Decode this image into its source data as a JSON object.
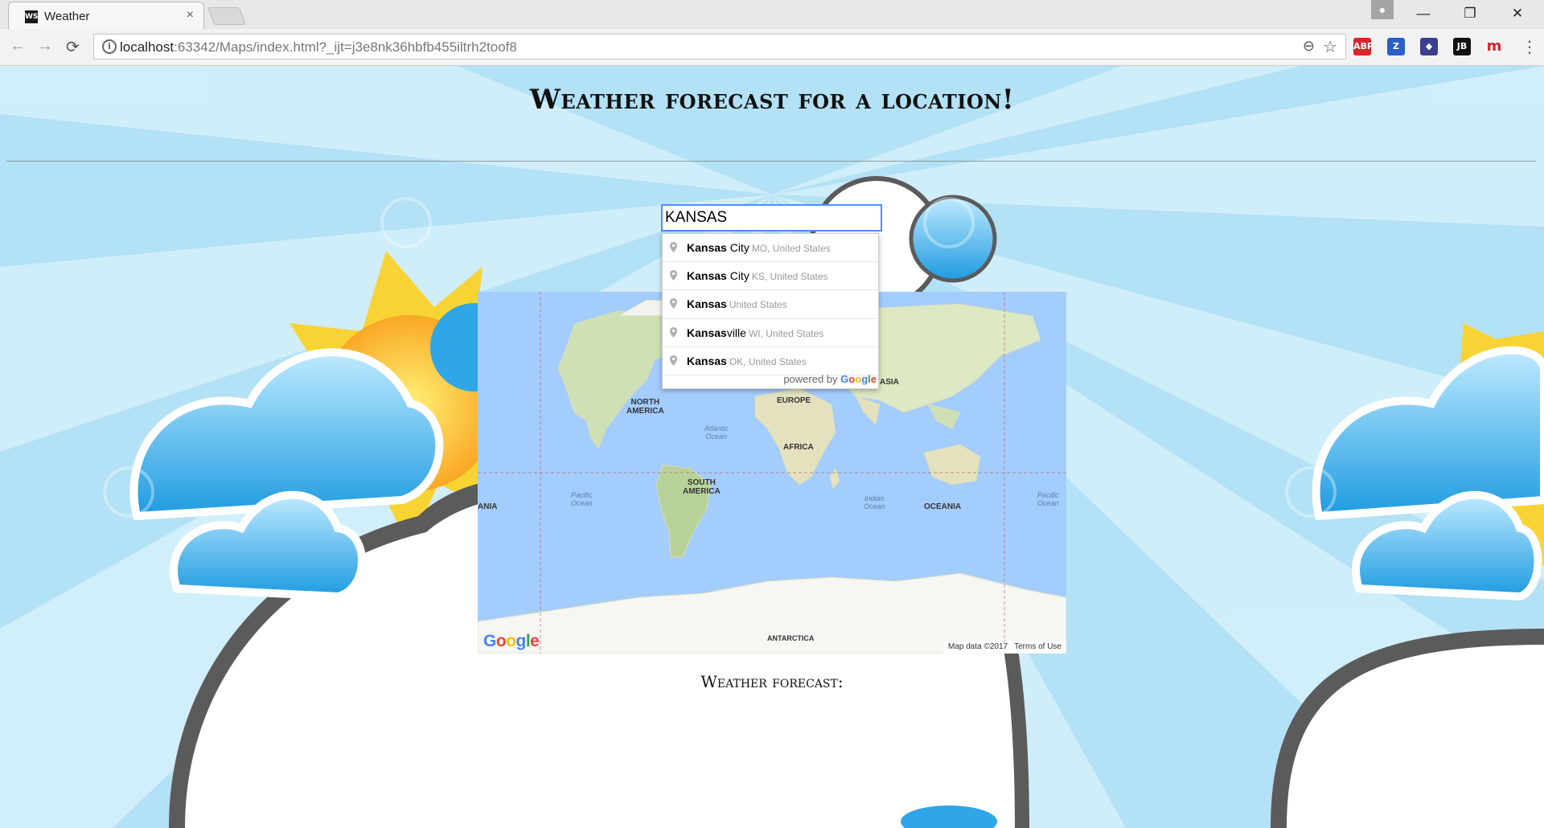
{
  "browser": {
    "tab_title": "Weather",
    "tab_favicon": "WS",
    "tab_close": "×",
    "url_host": "localhost",
    "url_rest": ":63342/Maps/index.html?_ijt=j3e8nk36hbfb455iltrh2toof8",
    "back_icon": "←",
    "forward_icon": "→",
    "reload_icon": "⟳",
    "minimize_icon": "—",
    "restore_icon": "❐",
    "close_icon": "✕",
    "extensions": [
      {
        "name": "adblock-plus-icon",
        "label": "ABP",
        "color": "#d8232a"
      },
      {
        "name": "zotero-icon",
        "label": "Z",
        "color": "#2b5fc7"
      },
      {
        "name": "extension-icon",
        "label": "◆",
        "color": "#3a3f8f"
      },
      {
        "name": "jetbrains-icon",
        "label": "JB",
        "color": "#111111"
      },
      {
        "name": "mendeley-icon",
        "label": "m",
        "color": "#ffffff"
      }
    ]
  },
  "page": {
    "title": "Weather forecast for a location!",
    "search_value": "KANSAS",
    "forecast_heading": "Weather forecast:"
  },
  "suggestions": [
    {
      "match": "Kansas",
      "rest": " City",
      "secondary": "MO, United States"
    },
    {
      "match": "Kansas",
      "rest": " City",
      "secondary": "KS, United States"
    },
    {
      "match": "Kansas",
      "rest": "",
      "secondary": "United States"
    },
    {
      "match": "Kansas",
      "rest": "ville",
      "secondary": "WI, United States"
    },
    {
      "match": "Kansas",
      "rest": "",
      "secondary": "OK, United States"
    }
  ],
  "powered_by": "powered by",
  "map": {
    "labels": {
      "north_america": "NORTH\nAMERICA",
      "south_america": "SOUTH\nAMERICA",
      "europe": "EUROPE",
      "asia": "ASIA",
      "africa": "AFRICA",
      "oceania": "OCEANIA",
      "oceania_left": "ANIA",
      "antarctica": "ANTARCTICA",
      "atlantic": "Atlantic\nOcean",
      "indian": "Indian\nOcean",
      "pacific_left": "Pacific\nOcean",
      "pacific_right": "Pacific\nOcean"
    },
    "google": "Google",
    "map_data": "Map data ©2017",
    "terms": "Terms of Use"
  },
  "colors": {
    "sky": "#b9e4f6",
    "ocean": "#a3ccff",
    "focus": "#4d90fe"
  }
}
